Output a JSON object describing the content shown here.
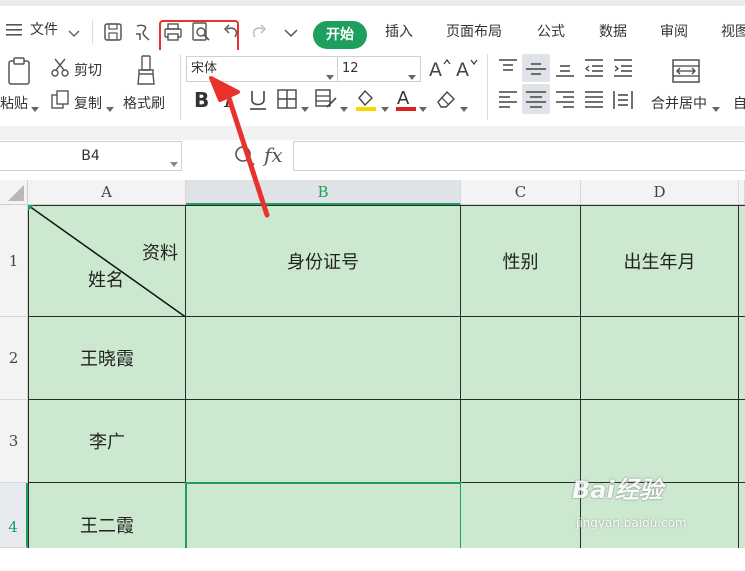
{
  "menubar": {
    "file_label": "文件",
    "tabs": [
      {
        "label": "开始",
        "active": true
      },
      {
        "label": "插入"
      },
      {
        "label": "页面布局"
      },
      {
        "label": "公式"
      },
      {
        "label": "数据"
      },
      {
        "label": "审阅"
      },
      {
        "label": "视图"
      }
    ],
    "quick_icons": [
      "save-icon",
      "format-painter-icon",
      "print-icon",
      "print-preview-icon",
      "undo-icon",
      "redo-icon",
      "more-chevron-icon"
    ]
  },
  "ribbon": {
    "paste_label": "粘贴",
    "cut_label": "剪切",
    "copy_label": "复制",
    "format_painter_label": "格式刷",
    "font_name": "宋体",
    "font_size": "12",
    "merge_center_label": "合并居中",
    "auto_label": "自"
  },
  "formula_bar": {
    "name_box": "B4",
    "fx_label": "fx",
    "formula_value": ""
  },
  "sheet": {
    "columns": [
      "A",
      "B",
      "C",
      "D"
    ],
    "rows": [
      "1",
      "2",
      "3",
      "4"
    ],
    "header_row": {
      "a_top": "资料",
      "a_bottom": "姓名",
      "b": "身份证号",
      "c": "性别",
      "d": "出生年月"
    },
    "names": [
      "王晓霞",
      "李广",
      "王二霞"
    ],
    "selected_cell": "B4",
    "cell_fill_color": "#cce8cf",
    "accent_color": "#1e9f5e"
  },
  "annotation": {
    "color": "#e8322b"
  },
  "watermark": {
    "brand": "Bai经验",
    "url": "jingyan.baidu.com"
  }
}
